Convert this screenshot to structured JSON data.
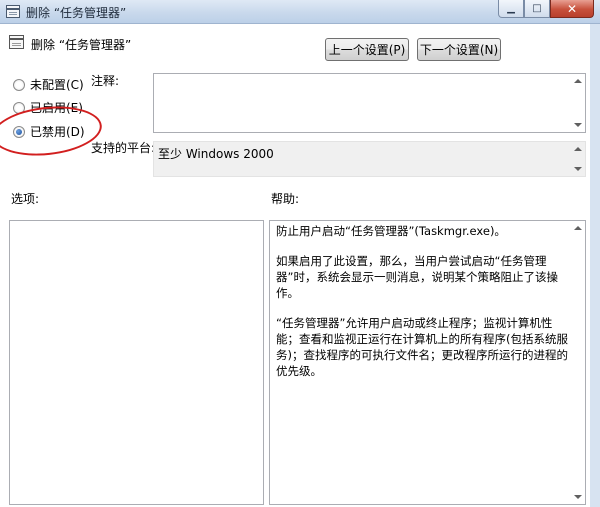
{
  "window": {
    "title": "删除 “任务管理器”",
    "min_glyph": "▁",
    "max_glyph": "□",
    "close_glyph": "✕"
  },
  "header": {
    "policy_name": "删除 “任务管理器”",
    "prev_button": "上一个设置(P)",
    "next_button": "下一个设置(N)"
  },
  "state_options": [
    {
      "label": "未配置(C)",
      "checked": false
    },
    {
      "label": "已启用(E)",
      "checked": false
    },
    {
      "label": "已禁用(D)",
      "checked": true
    }
  ],
  "comment": {
    "label": "注释:",
    "value": ""
  },
  "supported": {
    "label": "支持的平台:",
    "value": "至少 Windows 2000"
  },
  "options": {
    "label": "选项:"
  },
  "help": {
    "label": "帮助:",
    "paragraphs": [
      "防止用户启动“任务管理器”(Taskmgr.exe)。",
      "如果启用了此设置，那么，当用户尝试启动“任务管理器”时，系统会显示一则消息，说明某个策略阻止了该操作。",
      "“任务管理器”允许用户启动或终止程序；监视计算机性能；查看和监视正运行在计算机上的所有程序(包括系统服务)；查找程序的可执行文件名；更改程序所运行的进程的优先级。"
    ]
  },
  "colors": {
    "highlight_oval": "#d21f1f",
    "close_button": "#c7503b"
  }
}
